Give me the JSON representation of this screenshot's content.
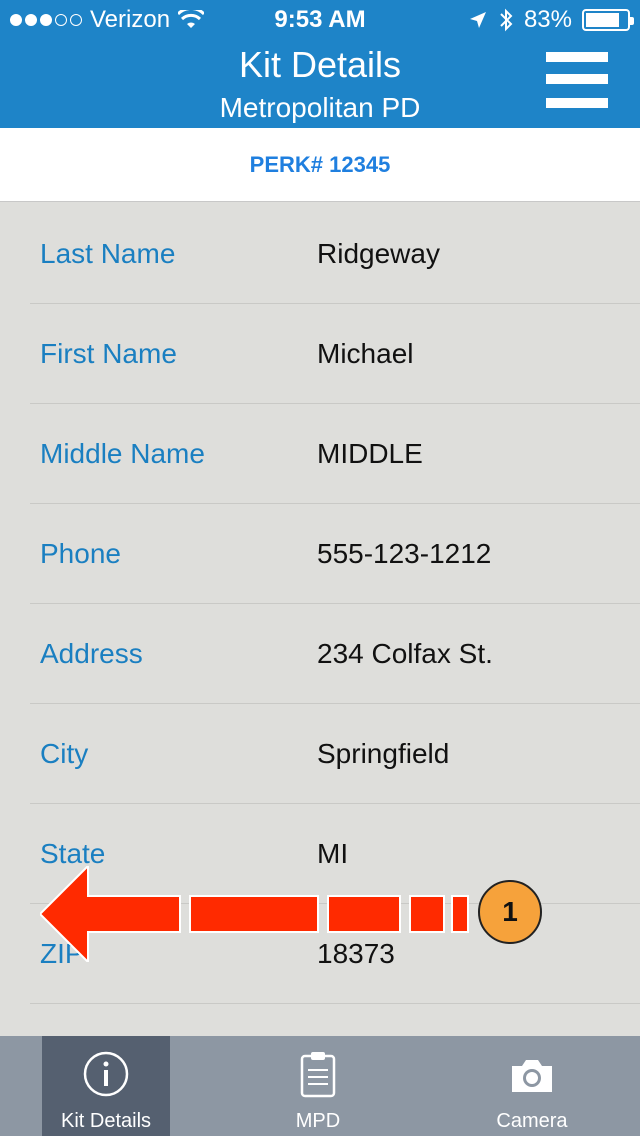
{
  "status_bar": {
    "carrier": "Verizon",
    "time": "9:53 AM",
    "battery": "83%",
    "battery_level": 0.83
  },
  "header": {
    "title": "Kit Details",
    "subtitle": "Metropolitan PD"
  },
  "perk": {
    "label": "PERK# 12345"
  },
  "fields": [
    {
      "label": "Last Name",
      "value": "Ridgeway"
    },
    {
      "label": "First Name",
      "value": "Michael"
    },
    {
      "label": "Middle Name",
      "value": "MIDDLE"
    },
    {
      "label": "Phone",
      "value": "555-123-1212"
    },
    {
      "label": "Address",
      "value": "234 Colfax St."
    },
    {
      "label": "City",
      "value": "Springfield"
    },
    {
      "label": "State",
      "value": "MI"
    },
    {
      "label": "ZIP",
      "value": "18373"
    }
  ],
  "annotation": {
    "number": "1",
    "arrow_color": "#ff2a00",
    "badge_color": "#f6a23b"
  },
  "tabs": [
    {
      "label": "Kit Details",
      "icon": "info-icon",
      "active": true
    },
    {
      "label": "MPD",
      "icon": "clipboard-icon",
      "active": false
    },
    {
      "label": "Camera",
      "icon": "camera-icon",
      "active": false
    }
  ],
  "colors": {
    "header_bg": "#1e84c8",
    "label_blue": "#1a7fc1",
    "perk_blue": "#1f7fdf",
    "tabbar_bg": "#8d97a3",
    "tab_active_bg": "#556070"
  }
}
